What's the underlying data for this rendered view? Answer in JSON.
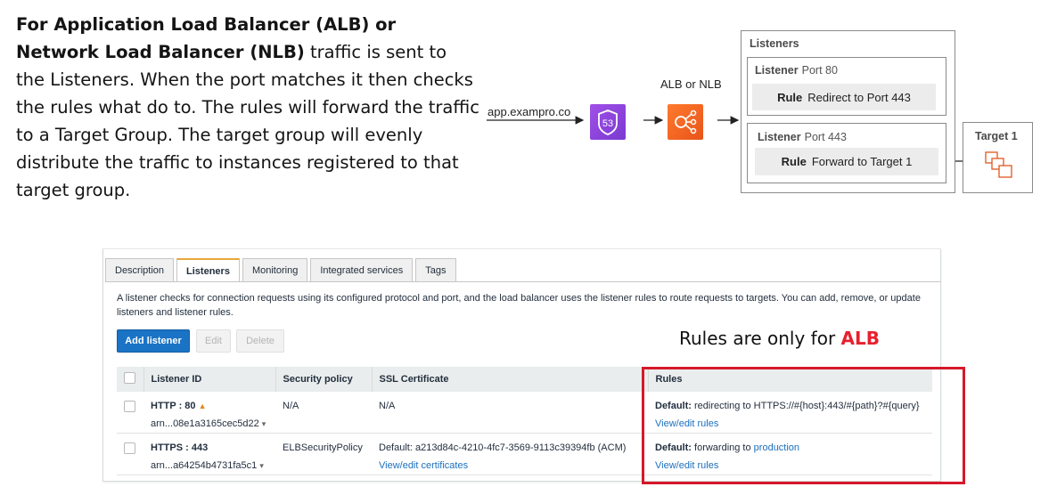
{
  "intro": {
    "bold": "For Application Load Balancer (ALB) or Network Load Balancer (NLB)",
    "rest": " traffic is sent to the Listeners. When the port matches it then checks the rules what do to. The rules will forward the traffic to a Target Group. The target group will evenly distribute the traffic to instances registered to that target group."
  },
  "diagram": {
    "source_label": "app.exampro.co",
    "r53_text": "53",
    "lb_label": "ALB or NLB",
    "listeners_title": "Listeners",
    "listener1": {
      "name": "Listener",
      "port": "Port 80",
      "rule_key": "Rule",
      "rule_value": "Redirect to Port 443"
    },
    "listener2": {
      "name": "Listener",
      "port": "Port 443",
      "rule_key": "Rule",
      "rule_value": "Forward to Target 1"
    },
    "target_title": "Target 1",
    "colors": {
      "route53": "#8c45e0",
      "elb": "#f26b21",
      "target_icon": "#e0581e"
    }
  },
  "console": {
    "tabs": [
      "Description",
      "Listeners",
      "Monitoring",
      "Integrated services",
      "Tags"
    ],
    "active_tab": "Listeners",
    "description": "A listener checks for connection requests using its configured protocol and port, and the load balancer uses the listener rules to route requests to targets. You can add, remove, or update listeners and listener rules.",
    "buttons": {
      "add": "Add listener",
      "edit": "Edit",
      "delete": "Delete"
    },
    "columns": [
      "Listener ID",
      "Security policy",
      "SSL Certificate",
      "Rules"
    ],
    "rows": [
      {
        "listener": "HTTP : 80",
        "warn_icon": "▲",
        "arn": "arn...08e1a3165cec5d22",
        "policy": "N/A",
        "cert_main": "N/A",
        "cert_link": "",
        "rule_default": "Default:",
        "rule_text": "redirecting to HTTPS://#{host}:443/#{path}?#{query}",
        "rule_target": "",
        "rule_link": "View/edit rules"
      },
      {
        "listener": "HTTPS : 443",
        "warn_icon": "",
        "arn": "arn...a64254b4731fa5c1",
        "policy": "ELBSecurityPolicy",
        "cert_main": "Default:  a213d84c-4210-4fc7-3569-9113c39394fb (ACM)",
        "cert_link": "View/edit certificates",
        "rule_default": "Default:",
        "rule_text": "forwarding to",
        "rule_target": "production",
        "rule_link": "View/edit rules"
      }
    ],
    "caret": "▾"
  },
  "annotation": {
    "prefix": "Rules are only for ",
    "highlight": "ALB",
    "color": "#e8202e"
  }
}
